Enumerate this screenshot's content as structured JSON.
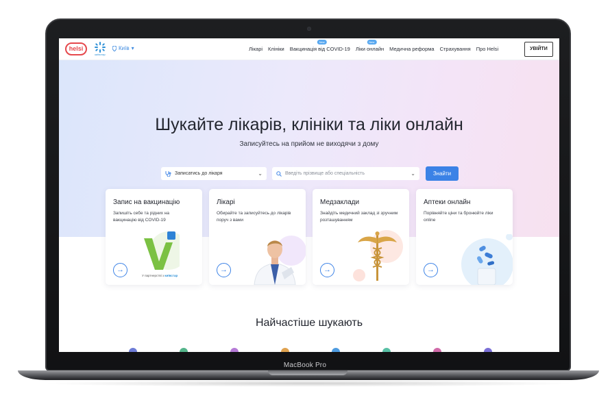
{
  "device": {
    "label": "MacBook Pro"
  },
  "header": {
    "logo_text": "helsi",
    "partner_logo_text": "київстар",
    "city": "Київ",
    "nav": [
      {
        "label": "Лікарі"
      },
      {
        "label": "Клініки"
      },
      {
        "label": "Вакцинація від COVID-19",
        "badge": "New"
      },
      {
        "label": "Ліки онлайн",
        "badge": "New"
      },
      {
        "label": "Медична реформа"
      },
      {
        "label": "Страхування"
      },
      {
        "label": "Про Helsi"
      }
    ],
    "login_label": "УВІЙТИ"
  },
  "hero": {
    "title": "Шукайте лікарів, клініки та ліки онлайн",
    "subtitle": "Записуйтесь на прийом не виходячи з дому",
    "select_type": "Записатись до лікаря",
    "search_placeholder": "Введіть прізвище або спеціальність",
    "search_button": "Знайти"
  },
  "cards": [
    {
      "title": "Запис на вакцинацію",
      "desc": "Запишіть себе та рідних на вакцинацію від COVID-19",
      "partner": "У партнерстві з",
      "partner_name": "київстар"
    },
    {
      "title": "Лікарі",
      "desc": "Обирайте та записуйтесь до лікарів поруч з вами"
    },
    {
      "title": "Медзаклади",
      "desc": "Знайдіть медичний заклад зі зручним розташуванням"
    },
    {
      "title": "Аптеки онлайн",
      "desc": "Порівняйте ціни та бронюйте ліки online"
    }
  ],
  "popular": {
    "title": "Найчастіше шукають"
  },
  "colors": {
    "accent": "#3b82e6",
    "brand_red": "#e5474b"
  }
}
